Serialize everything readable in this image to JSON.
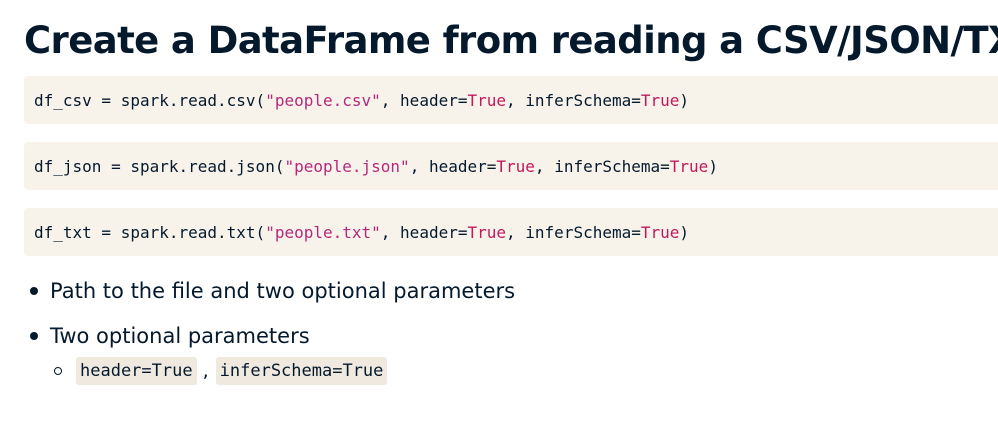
{
  "title": "Create a DataFrame from reading a CSV/JSON/TXT",
  "code_blocks": [
    {
      "prefix": "df_csv = spark.read.csv(",
      "string": "\"people.csv\"",
      "mid1": ", header=",
      "kw1": "True",
      "mid2": ", inferSchema=",
      "kw2": "True",
      "suffix": ")"
    },
    {
      "prefix": "df_json = spark.read.json(",
      "string": "\"people.json\"",
      "mid1": ", header=",
      "kw1": "True",
      "mid2": ", inferSchema=",
      "kw2": "True",
      "suffix": ")"
    },
    {
      "prefix": "df_txt = spark.read.txt(",
      "string": "\"people.txt\"",
      "mid1": ", header=",
      "kw1": "True",
      "mid2": ", inferSchema=",
      "kw2": "True",
      "suffix": ")"
    }
  ],
  "bullets": [
    "Path to the file and two optional parameters",
    "Two optional parameters"
  ],
  "sub_bullet": {
    "code1": "header=True",
    "separator": ",",
    "code2": "inferSchema=True"
  },
  "colors": {
    "text": "#05192d",
    "code_background": "#f7f3eb",
    "string": "#b4297a",
    "keyword": "#c2185b"
  }
}
